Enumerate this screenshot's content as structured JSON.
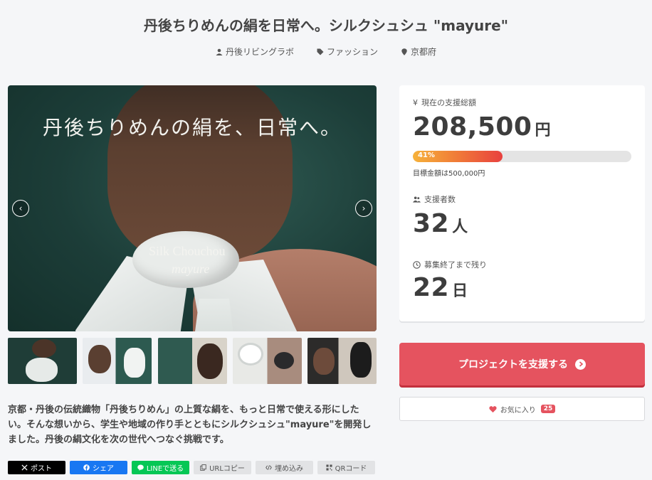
{
  "title": "丹後ちりめんの絹を日常へ。シルクシュシュ \"mayure\"",
  "meta": {
    "owner": "丹後リビングラボ",
    "category": "ファッション",
    "location": "京都府"
  },
  "hero": {
    "headline": "丹後ちりめんの絹を、日常へ。",
    "sub1": "Silk Chouchou",
    "sub2": "mayure",
    "prev": "‹",
    "next": "›"
  },
  "description": "京都・丹後の伝統織物「丹後ちりめん」の上質な絹を、もっと日常で使える形にしたい。そんな想いから、学生や地域の作り手とともにシルクシュシュ\"mayure\"を開発しました。丹後の絹文化を次の世代へつなぐ挑戦です。",
  "share": {
    "x": "ポスト",
    "facebook": "シェア",
    "line": "LINEで送る",
    "url": "URLコピー",
    "embed": "埋め込み",
    "qr": "QRコード"
  },
  "stats": {
    "amount_label": "現在の支援総額",
    "amount": "208,500",
    "amount_unit": "円",
    "progress_text": "41%",
    "progress": 0.41,
    "goal": "目標金額は500,000円",
    "backers_label": "支援者数",
    "backers": "32",
    "backers_unit": "人",
    "days_label": "募集終了まで残り",
    "days": "22",
    "days_unit": "日"
  },
  "support_button": "プロジェクトを支援する",
  "favorite": {
    "label": "お気に入り",
    "count": "25"
  },
  "colors": {
    "accent": "#e5535f",
    "background": "#f5f6f8",
    "facebook": "#1877f2",
    "line": "#06c755"
  }
}
